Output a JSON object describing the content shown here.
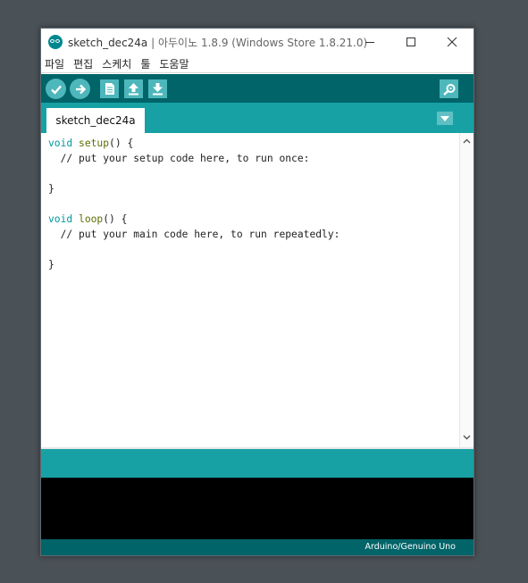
{
  "window": {
    "title_sketch": "sketch_dec24a",
    "title_rest": " | 아두이노 1.8.9 (Windows Store 1.8.21.0)"
  },
  "menu": [
    "파일",
    "편집",
    "스케치",
    "툴",
    "도움말"
  ],
  "toolbar": {
    "verify_icon": "check-icon",
    "upload_icon": "arrow-right-icon",
    "new_icon": "document-icon",
    "open_icon": "arrow-up-icon",
    "save_icon": "arrow-down-icon",
    "serial_monitor_icon": "magnifier-icon"
  },
  "tab": {
    "label": "sketch_dec24a"
  },
  "code": {
    "l1_kw": "void",
    "l1_fn": "setup",
    "l1_rest": "() {",
    "l2": "  // put your setup code here, to run once:",
    "l4": "}",
    "l6_kw": "void",
    "l6_fn": "loop",
    "l6_rest": "() {",
    "l7": "  // put your main code here, to run repeatedly:",
    "l9": "}"
  },
  "footer": {
    "board": "Arduino/Genuino Uno"
  },
  "colors": {
    "toolbar": "#006468",
    "tabbar": "#17a1a5",
    "button": "#4db7bb",
    "keyword": "#00979c"
  }
}
